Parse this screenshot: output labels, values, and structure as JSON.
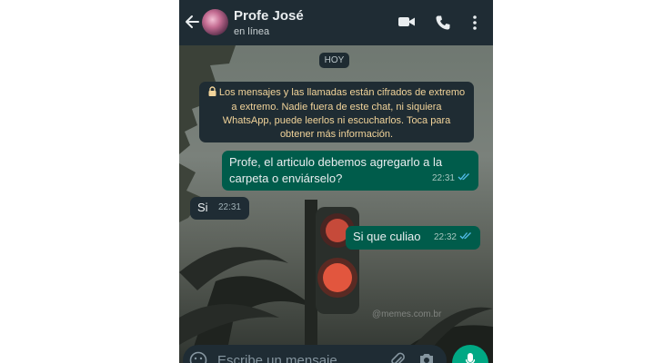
{
  "header": {
    "title": "Profe José",
    "status": "en línea"
  },
  "chat": {
    "date": "HOY",
    "encryption_notice": "Los mensajes y las llamadas están cifrados de extremo a extremo. Nadie fuera de este chat, ni siquiera WhatsApp, puede leerlos ni escucharlos. Toca para obtener más información.",
    "messages": [
      {
        "direction": "out",
        "text": "Profe, el articulo debemos agregarlo a la carpeta o enviárselo?",
        "time": "22:31",
        "status": "read"
      },
      {
        "direction": "in",
        "text": "Si",
        "time": "22:31"
      },
      {
        "direction": "out",
        "text": "Si que culiao",
        "time": "22:32",
        "status": "read"
      }
    ]
  },
  "watermark": "@memes.com.br",
  "composer": {
    "placeholder": "Escribe un mensaje"
  },
  "icons": [
    "back-arrow-icon",
    "video-call-icon",
    "phone-call-icon",
    "more-options-icon",
    "lock-icon",
    "double-check-icon",
    "emoji-icon",
    "attach-icon",
    "camera-icon",
    "mic-icon"
  ],
  "colors": {
    "header_bg": "#1f2c34",
    "outgoing_bubble": "#005c4b",
    "incoming_bubble": "#1f2c34",
    "notice_text": "#f2d49a",
    "read_ticks": "#53bdeb",
    "accent": "#00a884"
  }
}
